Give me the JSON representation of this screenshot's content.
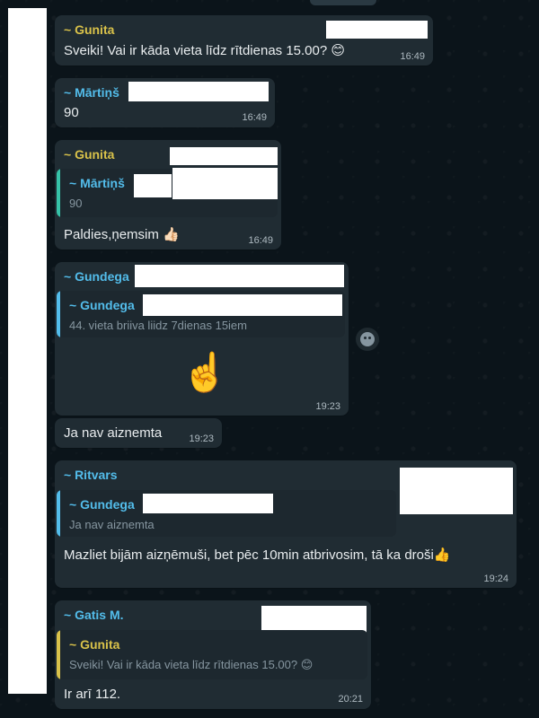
{
  "messages": [
    {
      "sender": "~ Gunita",
      "text": "Sveiki! Vai ir kāda vieta līdz rītdienas 15.00?",
      "emoji": "😊",
      "time": "16:49",
      "sender_color": "#d9c24a"
    },
    {
      "sender": "~ Mārtiņš",
      "text": "90",
      "time": "16:49",
      "sender_color": "#53bdeb"
    },
    {
      "sender": "~ Gunita",
      "quote": {
        "sender": "~ Mārtiņš",
        "text": "90"
      },
      "text": "Paldies,ņemsim",
      "emoji": "👍🏻",
      "time": "16:49",
      "sender_color": "#d9c24a"
    },
    {
      "sender": "~ Gundega",
      "quote": {
        "sender": "~ Gundega",
        "text": "44. vieta briiva liidz 7dienas 15iem"
      },
      "emoji": "☝️",
      "time": "19:23",
      "sender_color": "#53bdeb"
    },
    {
      "text": "Ja nav aiznemta",
      "time": "19:23"
    },
    {
      "sender": "~ Ritvars",
      "quote": {
        "sender": "~ Gundega",
        "text": "Ja nav aiznemta"
      },
      "text": "Mazliet bijām aizņēmuši, bet pēc 10min atbrivosim, tā ka droši",
      "emoji": "👍",
      "time": "19:24",
      "sender_color": "#53bdeb"
    },
    {
      "sender": "~ Gatis M.",
      "quote": {
        "sender": "~ Gunita",
        "text": "Sveiki! Vai ir kāda vieta līdz rītdienas 15.00?",
        "emoji": "😊"
      },
      "text": "Ir arī 112.",
      "time": "20:21",
      "sender_color": "#53bdeb"
    }
  ],
  "icons": {
    "react": "emoji-react-icon"
  }
}
